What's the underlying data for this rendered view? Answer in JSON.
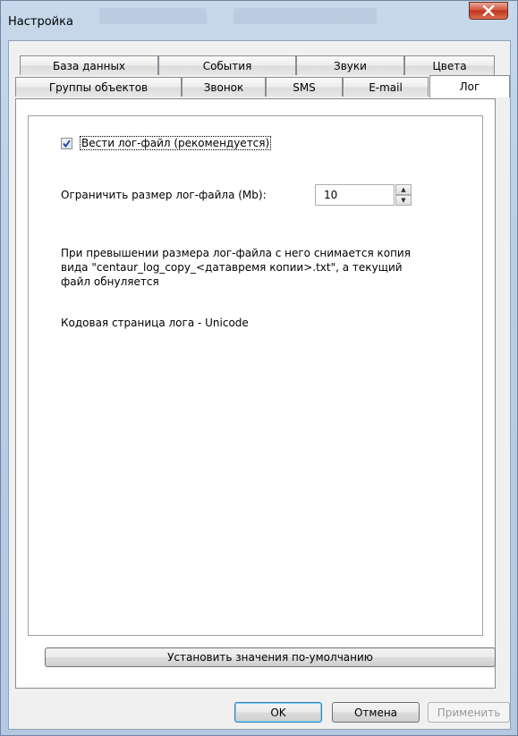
{
  "window": {
    "title": "Настройка"
  },
  "tabs_row1": [
    "База данных",
    "События",
    "Звуки",
    "Цвета"
  ],
  "tabs_row2": [
    "Группы объектов",
    "Звонок",
    "SMS",
    "E-mail",
    "Лог"
  ],
  "active_tab": "Лог",
  "log": {
    "checkbox_label": "Вести лог-файл (рекомендуется)",
    "checkbox_checked": true,
    "limit_label": "Ограничить размер лог-файла (Mb):",
    "limit_value": "10",
    "info_line1": "При превышении размера лог-файла с него снимается копия",
    "info_line2": "вида \"centaur_log_copy_<датавремя копии>.txt\", а текущий",
    "info_line3": "файл обнуляется",
    "codepage": "Кодовая страница лога - Unicode"
  },
  "buttons": {
    "set_defaults": "Установить значения по-умолчанию",
    "ok": "OK",
    "cancel": "Отмена",
    "apply": "Применить"
  }
}
